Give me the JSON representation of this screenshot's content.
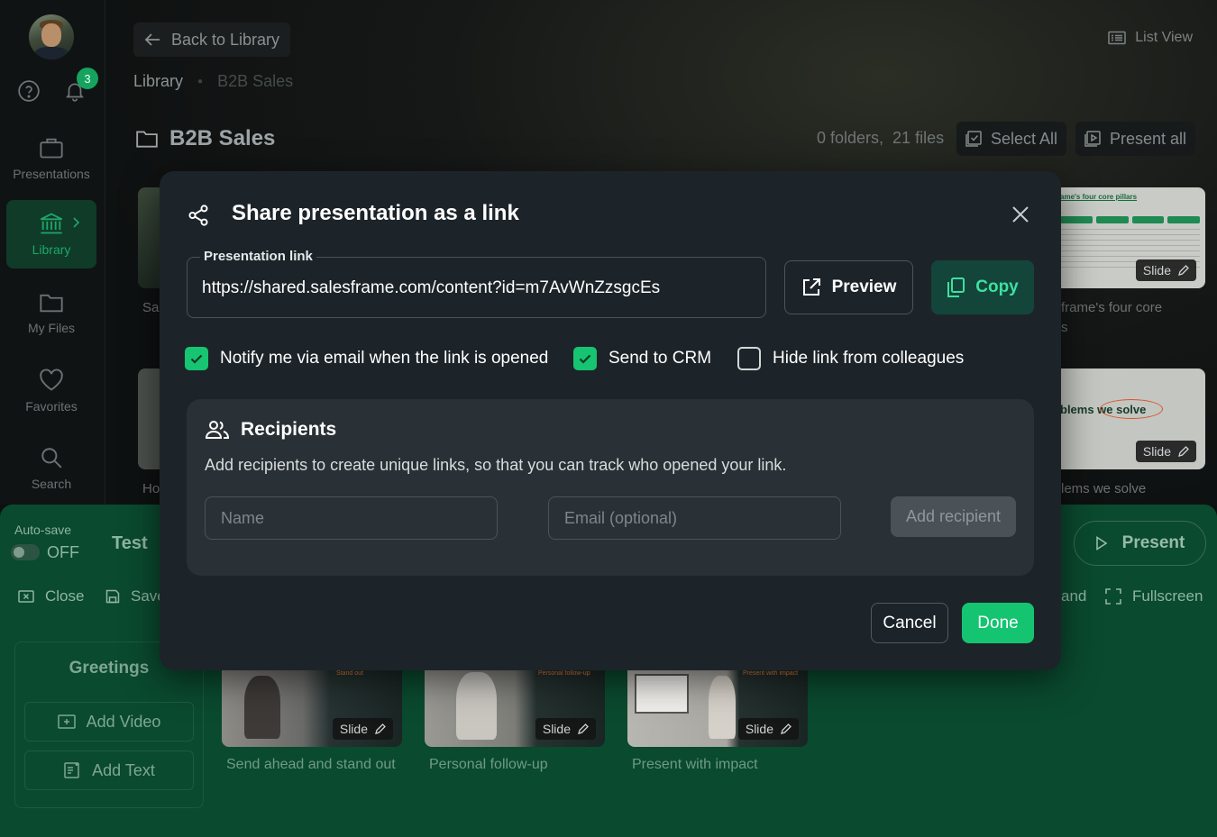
{
  "sidebar": {
    "notifications_count": "3",
    "items": [
      {
        "label": "Presentations",
        "icon": "briefcase-icon"
      },
      {
        "label": "Library",
        "icon": "bank-icon"
      },
      {
        "label": "My Files",
        "icon": "folder-icon"
      },
      {
        "label": "Favorites",
        "icon": "heart-icon"
      },
      {
        "label": "Search",
        "icon": "search-icon"
      }
    ]
  },
  "library": {
    "back_label": "Back to Library",
    "breadcrumb": [
      "Library",
      "B2B Sales"
    ],
    "list_view_label": "List View",
    "folder_title": "B2B Sales",
    "counts": "0 folders,  21 files",
    "select_all_label": "Select All",
    "present_all_label": "Present all",
    "cards": [
      {
        "caption_left": "Sal",
        "caption_right": "frame's four core\ns"
      },
      {
        "caption_left": "Ho",
        "caption_right": "lems we solve"
      }
    ],
    "thumb_text": [
      "ame's four core pillars",
      "blems we solve"
    ],
    "slide_tag": "Slide"
  },
  "editor": {
    "autosave_label": "Auto-save",
    "autosave_state": "OFF",
    "title": "Test",
    "close_label": "Close",
    "save_label": "Save",
    "expand_label": "and",
    "fullscreen_label": "Fullscreen",
    "present_label": "Present",
    "greetings_title": "Greetings",
    "add_video_label": "Add Video",
    "add_text_label": "Add Text",
    "slides": [
      {
        "caption": "Send ahead and stand out",
        "tag": "Slide",
        "overlay": "Stand out"
      },
      {
        "caption": "Personal follow-up",
        "tag": "Slide",
        "overlay": "Personal follow-up"
      },
      {
        "caption": "Present with impact",
        "tag": "Slide",
        "overlay": "Present with impact"
      }
    ]
  },
  "modal": {
    "title": "Share presentation as a link",
    "link_label": "Presentation link",
    "link_value": "https://shared.salesframe.com/content?id=m7AvWnZzsgcEs",
    "preview_label": "Preview",
    "copy_label": "Copy",
    "checkboxes": [
      {
        "label": "Notify me via email when the link is opened",
        "checked": true
      },
      {
        "label": "Send to CRM",
        "checked": true
      },
      {
        "label": "Hide link from colleagues",
        "checked": false
      }
    ],
    "recipients": {
      "title": "Recipients",
      "description": "Add recipients to create unique links, so that you can track who opened your link.",
      "name_placeholder": "Name",
      "email_placeholder": "Email (optional)",
      "add_label": "Add recipient"
    },
    "cancel_label": "Cancel",
    "done_label": "Done"
  },
  "colors": {
    "accent": "#15c471",
    "editor_bg": "#0a4a2f",
    "modal_bg": "#1d2429"
  }
}
